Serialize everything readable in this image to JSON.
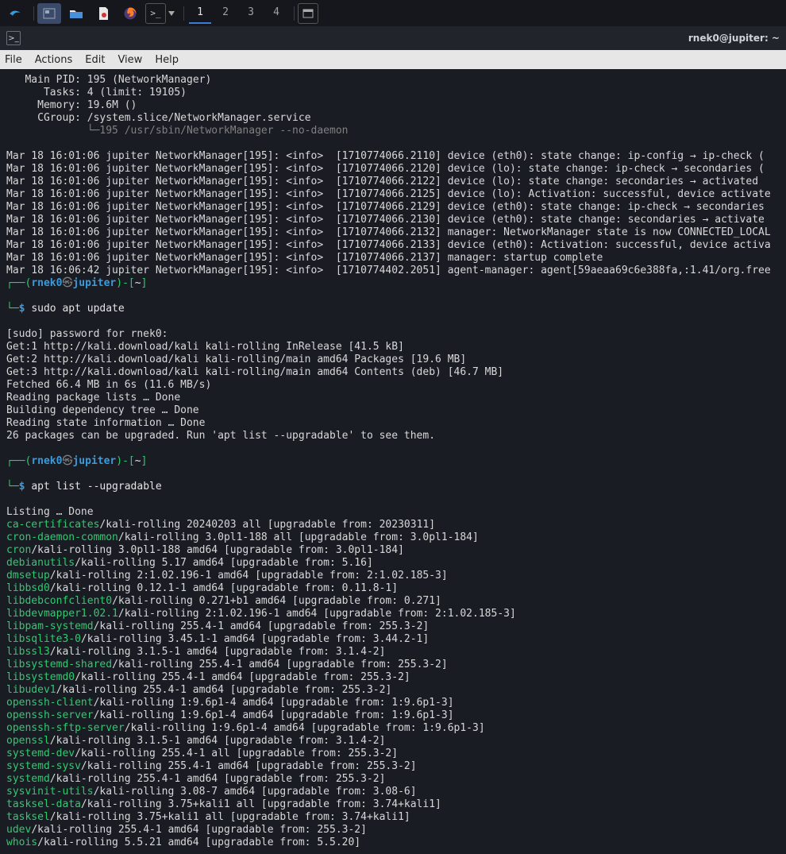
{
  "taskbar": {
    "workspaces": [
      "1",
      "2",
      "3",
      "4"
    ],
    "active_ws": 0
  },
  "window": {
    "title": "rnek0@jupiter: ~"
  },
  "menubar": [
    "File",
    "Actions",
    "Edit",
    "View",
    "Help"
  ],
  "status": {
    "main_pid_label": "Main PID:",
    "main_pid_value": "195 (NetworkManager)",
    "tasks_label": "Tasks:",
    "tasks_value": "4 (limit: 19105)",
    "memory_label": "Memory:",
    "memory_value": "19.6M ()",
    "cgroup_label": "CGroup:",
    "cgroup_value": "/system.slice/NetworkManager.service",
    "cgroup_tree": "└─195 /usr/sbin/NetworkManager --no-daemon"
  },
  "loglines": [
    "Mar 18 16:01:06 jupiter NetworkManager[195]: <info>  [1710774066.2110] device (eth0): state change: ip-config → ip-check (",
    "Mar 18 16:01:06 jupiter NetworkManager[195]: <info>  [1710774066.2120] device (lo): state change: ip-check → secondaries (",
    "Mar 18 16:01:06 jupiter NetworkManager[195]: <info>  [1710774066.2122] device (lo): state change: secondaries → activated ",
    "Mar 18 16:01:06 jupiter NetworkManager[195]: <info>  [1710774066.2125] device (lo): Activation: successful, device activate",
    "Mar 18 16:01:06 jupiter NetworkManager[195]: <info>  [1710774066.2129] device (eth0): state change: ip-check → secondaries",
    "Mar 18 16:01:06 jupiter NetworkManager[195]: <info>  [1710774066.2130] device (eth0): state change: secondaries → activate",
    "Mar 18 16:01:06 jupiter NetworkManager[195]: <info>  [1710774066.2132] manager: NetworkManager state is now CONNECTED_LOCAL",
    "Mar 18 16:01:06 jupiter NetworkManager[195]: <info>  [1710774066.2133] device (eth0): Activation: successful, device activa",
    "Mar 18 16:01:06 jupiter NetworkManager[195]: <info>  [1710774066.2137] manager: startup complete",
    "Mar 18 16:06:42 jupiter NetworkManager[195]: <info>  [1710774402.2051] agent-manager: agent[59aeaa69c6e388fa,:1.41/org.free"
  ],
  "prompt": {
    "user": "rnek0",
    "host": "jupiter",
    "skull": "㉿",
    "path": "~",
    "symbol": "$"
  },
  "cmd1": "sudo apt update",
  "apt_update": [
    "[sudo] password for rnek0:",
    "Get:1 http://kali.download/kali kali-rolling InRelease [41.5 kB]",
    "Get:2 http://kali.download/kali kali-rolling/main amd64 Packages [19.6 MB]",
    "Get:3 http://kali.download/kali kali-rolling/main amd64 Contents (deb) [46.7 MB]",
    "Fetched 66.4 MB in 6s (11.6 MB/s)",
    "Reading package lists … Done",
    "Building dependency tree … Done",
    "Reading state information … Done",
    "26 packages can be upgraded. Run 'apt list --upgradable' to see them."
  ],
  "cmd2": "apt list --upgradable",
  "listing_header": "Listing … Done",
  "packages": [
    {
      "name": "ca-certificates",
      "rest": "/kali-rolling 20240203 all [upgradable from: 20230311]"
    },
    {
      "name": "cron-daemon-common",
      "rest": "/kali-rolling 3.0pl1-188 all [upgradable from: 3.0pl1-184]"
    },
    {
      "name": "cron",
      "rest": "/kali-rolling 3.0pl1-188 amd64 [upgradable from: 3.0pl1-184]"
    },
    {
      "name": "debianutils",
      "rest": "/kali-rolling 5.17 amd64 [upgradable from: 5.16]"
    },
    {
      "name": "dmsetup",
      "rest": "/kali-rolling 2:1.02.196-1 amd64 [upgradable from: 2:1.02.185-3]"
    },
    {
      "name": "libbsd0",
      "rest": "/kali-rolling 0.12.1-1 amd64 [upgradable from: 0.11.8-1]"
    },
    {
      "name": "libdebconfclient0",
      "rest": "/kali-rolling 0.271+b1 amd64 [upgradable from: 0.271]"
    },
    {
      "name": "libdevmapper1.02.1",
      "rest": "/kali-rolling 2:1.02.196-1 amd64 [upgradable from: 2:1.02.185-3]"
    },
    {
      "name": "libpam-systemd",
      "rest": "/kali-rolling 255.4-1 amd64 [upgradable from: 255.3-2]"
    },
    {
      "name": "libsqlite3-0",
      "rest": "/kali-rolling 3.45.1-1 amd64 [upgradable from: 3.44.2-1]"
    },
    {
      "name": "libssl3",
      "rest": "/kali-rolling 3.1.5-1 amd64 [upgradable from: 3.1.4-2]"
    },
    {
      "name": "libsystemd-shared",
      "rest": "/kali-rolling 255.4-1 amd64 [upgradable from: 255.3-2]"
    },
    {
      "name": "libsystemd0",
      "rest": "/kali-rolling 255.4-1 amd64 [upgradable from: 255.3-2]"
    },
    {
      "name": "libudev1",
      "rest": "/kali-rolling 255.4-1 amd64 [upgradable from: 255.3-2]"
    },
    {
      "name": "openssh-client",
      "rest": "/kali-rolling 1:9.6p1-4 amd64 [upgradable from: 1:9.6p1-3]"
    },
    {
      "name": "openssh-server",
      "rest": "/kali-rolling 1:9.6p1-4 amd64 [upgradable from: 1:9.6p1-3]"
    },
    {
      "name": "openssh-sftp-server",
      "rest": "/kali-rolling 1:9.6p1-4 amd64 [upgradable from: 1:9.6p1-3]"
    },
    {
      "name": "openssl",
      "rest": "/kali-rolling 3.1.5-1 amd64 [upgradable from: 3.1.4-2]"
    },
    {
      "name": "systemd-dev",
      "rest": "/kali-rolling 255.4-1 all [upgradable from: 255.3-2]"
    },
    {
      "name": "systemd-sysv",
      "rest": "/kali-rolling 255.4-1 amd64 [upgradable from: 255.3-2]"
    },
    {
      "name": "systemd",
      "rest": "/kali-rolling 255.4-1 amd64 [upgradable from: 255.3-2]"
    },
    {
      "name": "sysvinit-utils",
      "rest": "/kali-rolling 3.08-7 amd64 [upgradable from: 3.08-6]"
    },
    {
      "name": "tasksel-data",
      "rest": "/kali-rolling 3.75+kali1 all [upgradable from: 3.74+kali1]"
    },
    {
      "name": "tasksel",
      "rest": "/kali-rolling 3.75+kali1 all [upgradable from: 3.74+kali1]"
    },
    {
      "name": "udev",
      "rest": "/kali-rolling 255.4-1 amd64 [upgradable from: 255.3-2]"
    },
    {
      "name": "whois",
      "rest": "/kali-rolling 5.5.21 amd64 [upgradable from: 5.5.20]"
    }
  ]
}
